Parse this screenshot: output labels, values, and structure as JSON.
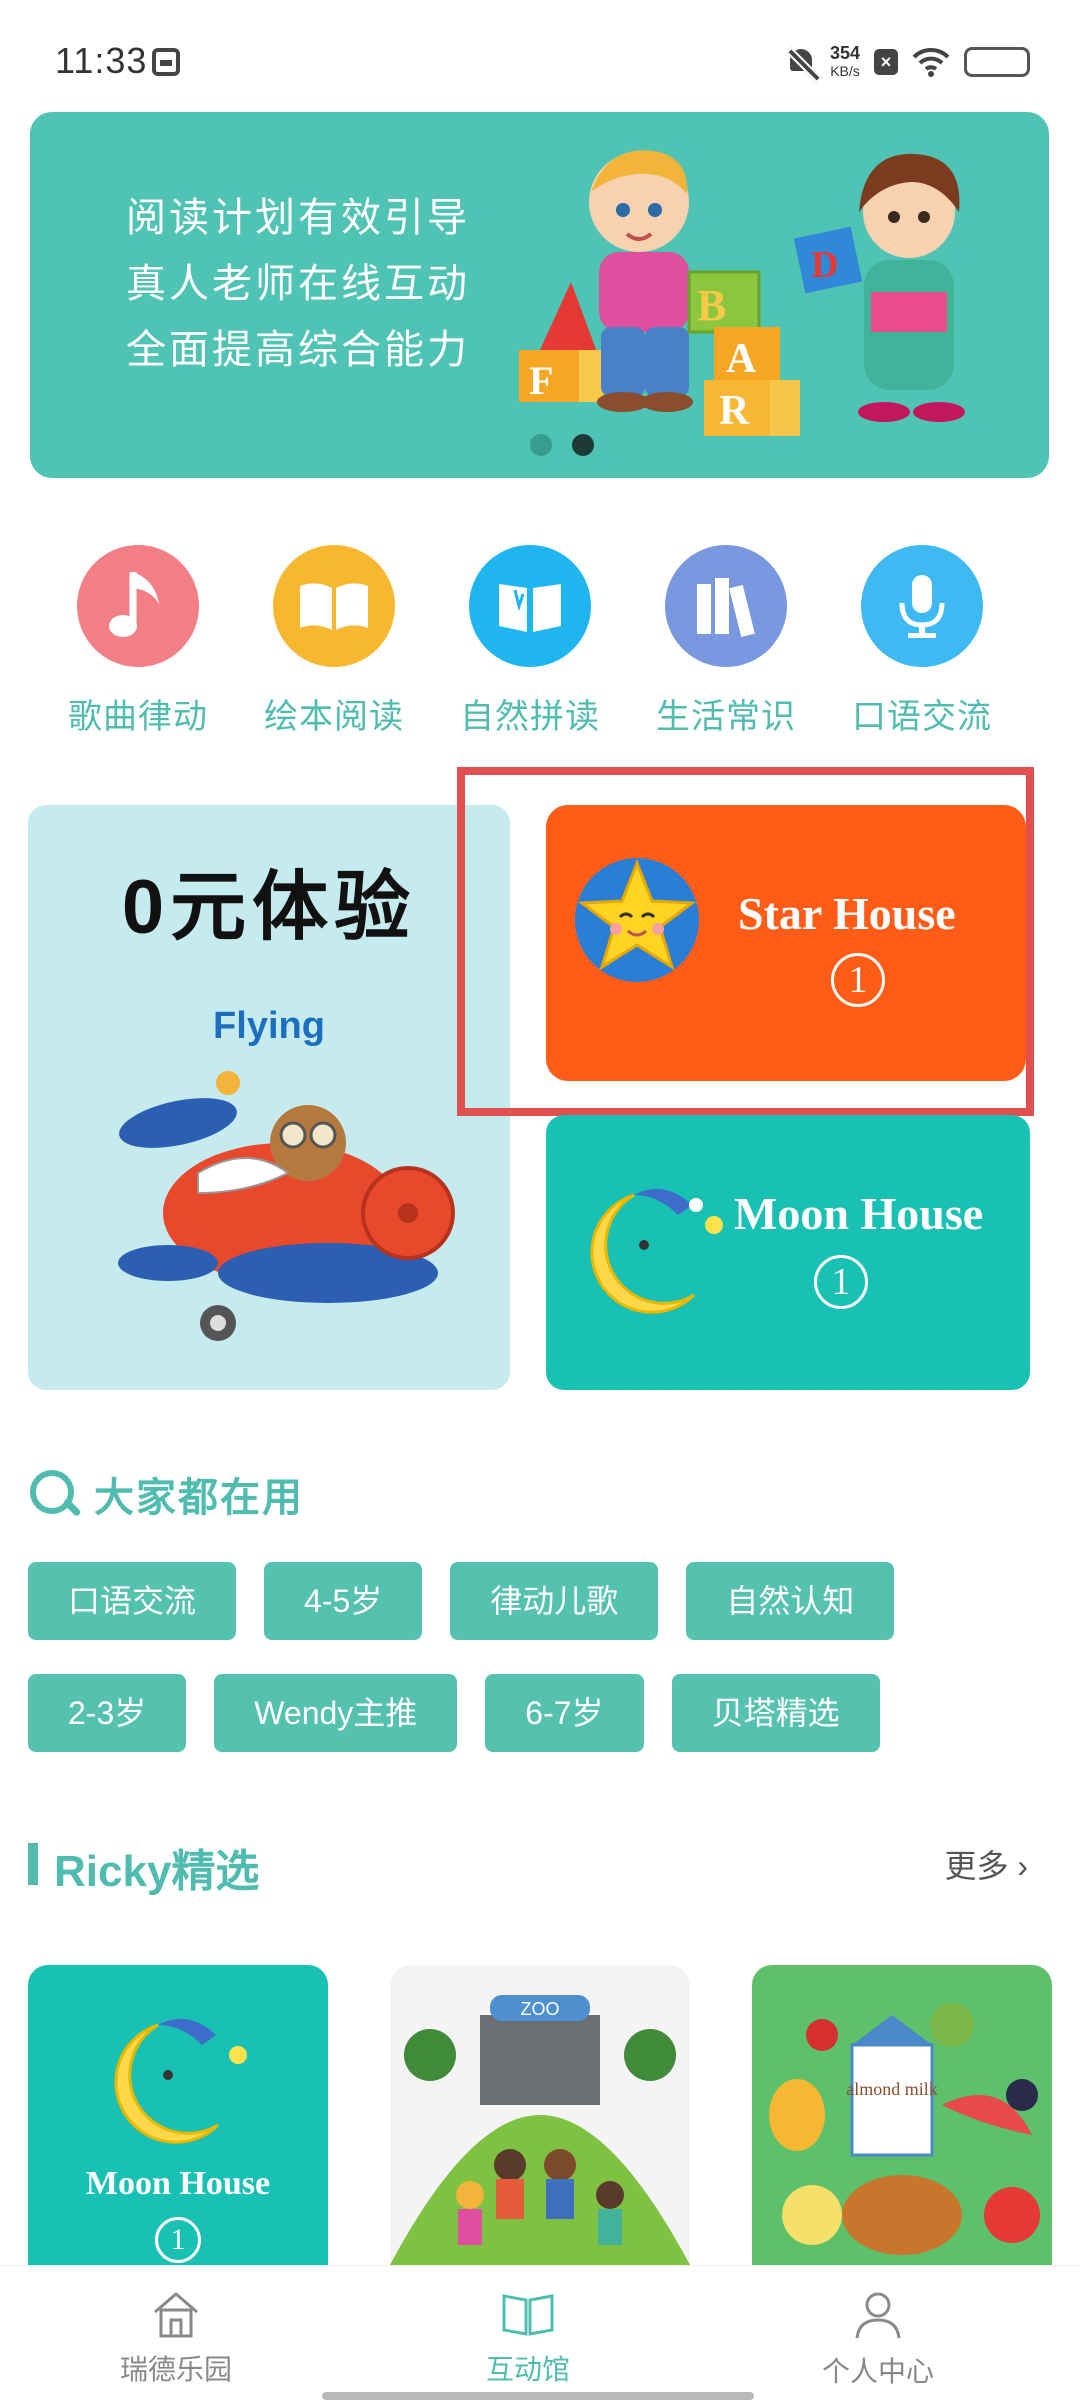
{
  "status_bar": {
    "time": "11:33",
    "speed_value": "354",
    "speed_unit": "KB/s",
    "icons": [
      "sim-card-icon",
      "bell-off-icon",
      "close-box-icon",
      "wifi-icon",
      "battery-icon"
    ]
  },
  "banner": {
    "lines": [
      "阅读计划有效引导",
      "真人老师在线互动",
      "全面提高综合能力"
    ],
    "background": "#4fc3b4",
    "page_count": 2,
    "active_page": 2
  },
  "categories": [
    {
      "label": "歌曲律动",
      "icon": "music-note-icon",
      "color": "#f37f86"
    },
    {
      "label": "绘本阅读",
      "icon": "open-book-icon",
      "color": "#f7b731"
    },
    {
      "label": "自然拼读",
      "icon": "phonics-book-icon",
      "color": "#1fb6f0"
    },
    {
      "label": "生活常识",
      "icon": "books-icon",
      "color": "#7a98e0"
    },
    {
      "label": "口语交流",
      "icon": "microphone-icon",
      "color": "#3fb9f2"
    }
  ],
  "promo": {
    "free_trial_title": "0元体验",
    "free_trial_book": "Flying",
    "star_house_title": "Star House",
    "star_house_number": "1",
    "moon_house_title": "Moon House",
    "moon_house_number": "1",
    "colors": {
      "star": "#ff5c17",
      "moon": "#18c1b4",
      "free": "#c6ebef",
      "highlight": "#e24f4f"
    }
  },
  "popular": {
    "title": "大家都在用",
    "tags_row1": [
      "口语交流",
      "4-5岁",
      "律动儿歌",
      "自然认知"
    ],
    "tags_row2": [
      "2-3岁",
      "Wendy主推",
      "6-7岁",
      "贝塔精选"
    ]
  },
  "ricky": {
    "title": "Ricky精选",
    "more": "更多",
    "thumb1_title": "Moon House",
    "thumb1_number": "1",
    "thumb2_sign": "ZOO",
    "thumb3_label": "almond milk"
  },
  "bottom_nav": [
    {
      "label": "瑞德乐园",
      "icon": "home-icon",
      "active": false
    },
    {
      "label": "互动馆",
      "icon": "book-icon",
      "active": true
    },
    {
      "label": "个人中心",
      "icon": "person-icon",
      "active": false
    }
  ],
  "accent_color": "#4fbcaf"
}
